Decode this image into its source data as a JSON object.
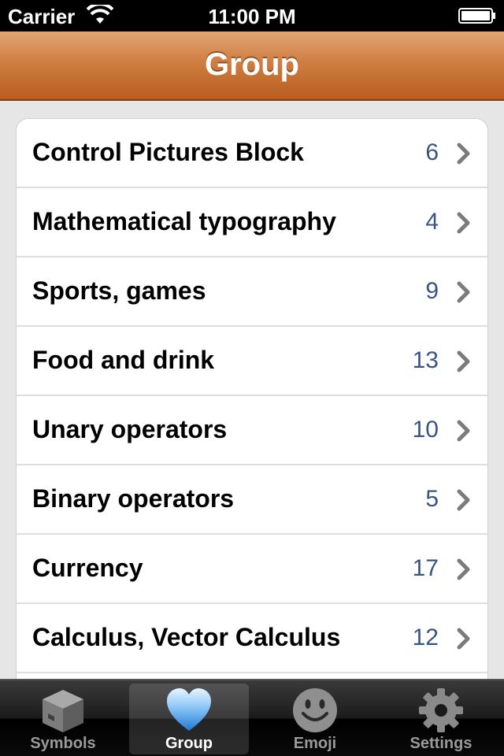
{
  "status": {
    "carrier": "Carrier",
    "time": "11:00 PM"
  },
  "navigation": {
    "title": "Group"
  },
  "groups": [
    {
      "label": "Control Pictures Block",
      "count": "6"
    },
    {
      "label": "Mathematical typography",
      "count": "4"
    },
    {
      "label": "Sports, games",
      "count": "9"
    },
    {
      "label": "Food and drink",
      "count": "13"
    },
    {
      "label": "Unary operators",
      "count": "10"
    },
    {
      "label": "Binary operators",
      "count": "5"
    },
    {
      "label": "Currency",
      "count": "17"
    },
    {
      "label": "Calculus, Vector Calculus",
      "count": "12"
    }
  ],
  "tabs": [
    {
      "label": "Symbols",
      "icon": "box-icon"
    },
    {
      "label": "Group",
      "icon": "heart-icon"
    },
    {
      "label": "Emoji",
      "icon": "smiley-icon"
    },
    {
      "label": "Settings",
      "icon": "gear-icon"
    }
  ],
  "selected_tab": "Group",
  "colors": {
    "nav_bar": "#cf7e42",
    "count_text": "#385487",
    "selected_icon": "#4aa3f0"
  }
}
